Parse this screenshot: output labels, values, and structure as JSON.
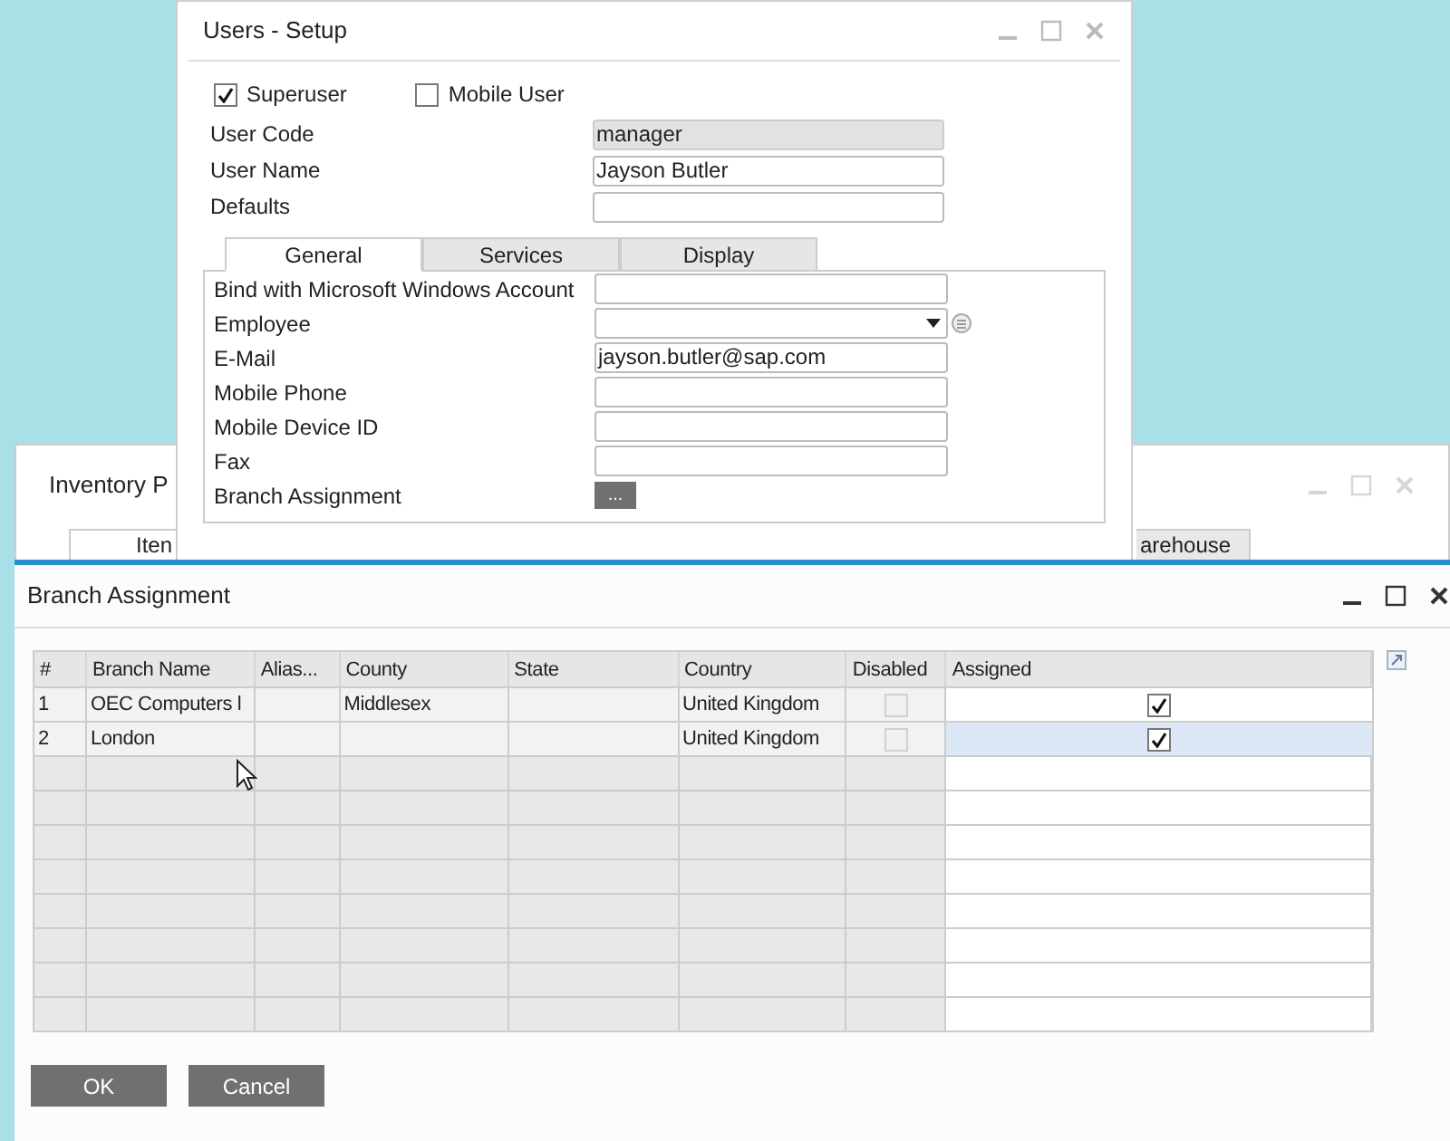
{
  "inventory_window": {
    "title": "Inventory P",
    "tabs": [
      {
        "label": "Iten",
        "selected": true
      },
      {
        "label": "arehouse",
        "selected": false
      }
    ]
  },
  "users_window": {
    "title": "Users - Setup",
    "checkboxes": [
      {
        "label": "Superuser",
        "checked": true
      },
      {
        "label": "Mobile User",
        "checked": false
      }
    ],
    "fields": [
      {
        "label": "User Code",
        "value": "manager",
        "disabled": true
      },
      {
        "label": "User Name",
        "value": "Jayson Butler",
        "disabled": false
      },
      {
        "label": "Defaults",
        "disabled": false
      }
    ],
    "tabs": [
      {
        "label": "General",
        "selected": true
      },
      {
        "label": "Services",
        "selected": false
      },
      {
        "label": "Display",
        "selected": false
      }
    ],
    "general_fields": [
      {
        "label": "Bind with Microsoft Windows Account",
        "kind": "text"
      },
      {
        "label": "Employee",
        "kind": "dropdown"
      },
      {
        "label": "E-Mail",
        "kind": "text",
        "value": "jayson.butler@sap.com"
      },
      {
        "label": "Mobile Phone",
        "kind": "text"
      },
      {
        "label": "Mobile Device ID",
        "kind": "text"
      },
      {
        "label": "Fax",
        "kind": "text"
      },
      {
        "label": "Branch Assignment",
        "kind": "button",
        "value": "..."
      }
    ]
  },
  "branch_window": {
    "title": "Branch Assignment",
    "columns": [
      "#",
      "Branch Name",
      "Alias...",
      "County",
      "State",
      "Country",
      "Disabled",
      "Assigned"
    ],
    "rows": [
      {
        "cells": [
          "1",
          "OEC Computers l",
          "",
          "Middlesex",
          "",
          "United Kingdom"
        ],
        "disabled": false,
        "assigned": true,
        "selected": false
      },
      {
        "cells": [
          "2",
          "London",
          "",
          "",
          "",
          "United Kingdom"
        ],
        "disabled": false,
        "assigned": true,
        "selected": true
      }
    ],
    "buttons": [
      "OK",
      "Cancel"
    ]
  }
}
